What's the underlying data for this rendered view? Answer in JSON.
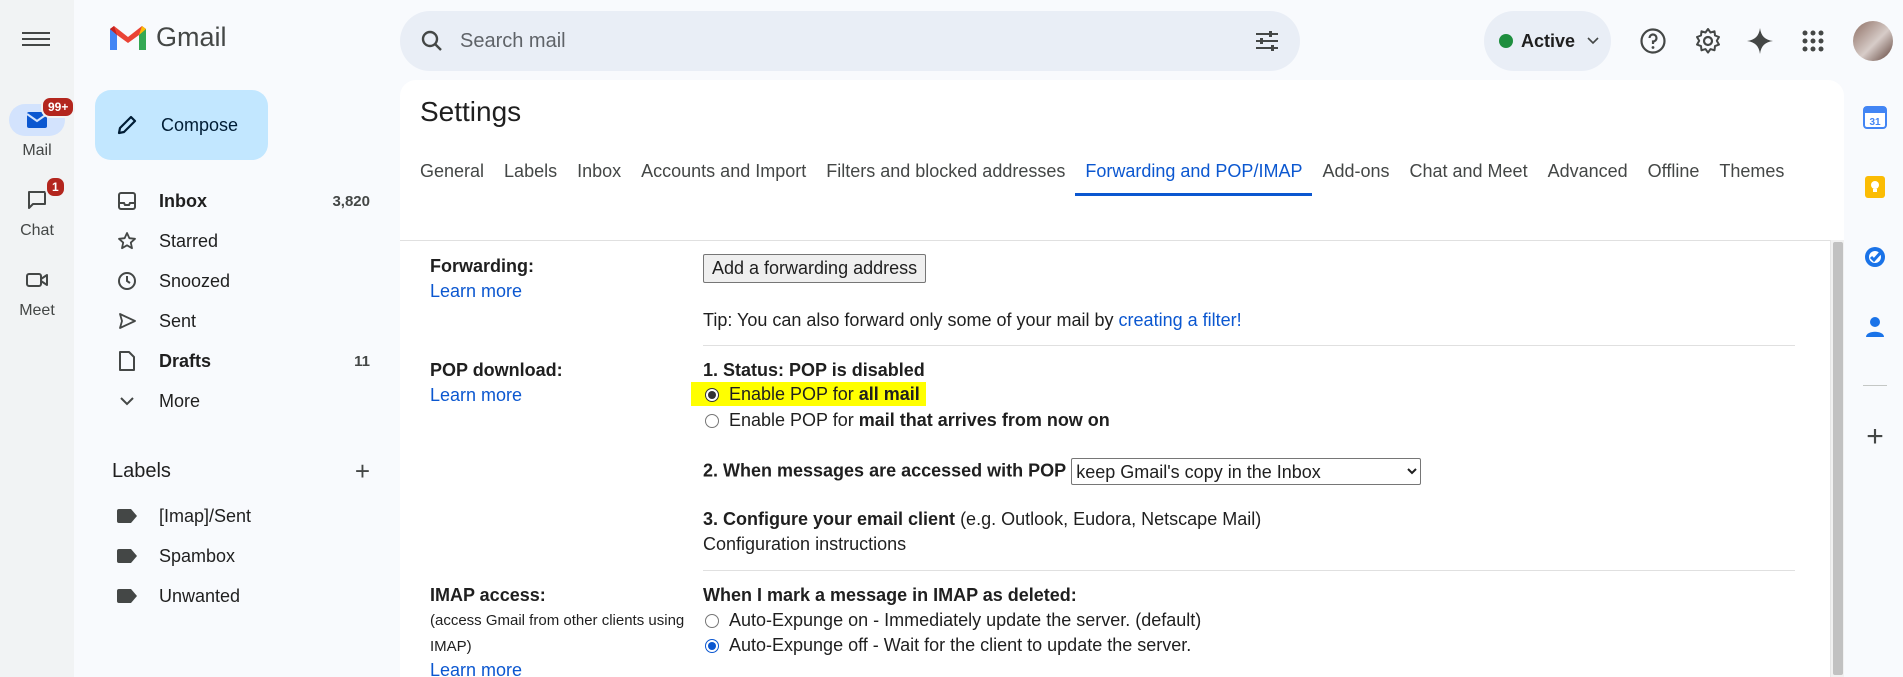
{
  "app": {
    "name": "Gmail"
  },
  "rail": [
    {
      "label": "Mail",
      "badge": "99+",
      "icon": "mail-icon"
    },
    {
      "label": "Chat",
      "badge": "1",
      "icon": "chat-icon"
    },
    {
      "label": "Meet",
      "badge": "",
      "icon": "video-icon"
    }
  ],
  "compose": {
    "label": "Compose"
  },
  "nav": [
    {
      "label": "Inbox",
      "count": "3,820",
      "icon": "inbox-icon",
      "bold": true
    },
    {
      "label": "Starred",
      "count": "",
      "icon": "star-icon"
    },
    {
      "label": "Snoozed",
      "count": "",
      "icon": "clock-icon"
    },
    {
      "label": "Sent",
      "count": "",
      "icon": "send-icon"
    },
    {
      "label": "Drafts",
      "count": "11",
      "icon": "draft-icon",
      "bold": true
    },
    {
      "label": "More",
      "count": "",
      "icon": "chevron-down-icon"
    }
  ],
  "labels": {
    "heading": "Labels",
    "items": [
      "[Imap]/Sent",
      "Spambox",
      "Unwanted"
    ]
  },
  "search": {
    "placeholder": "Search mail"
  },
  "status": {
    "label": "Active",
    "color": "#1e8e3e"
  },
  "settings": {
    "title": "Settings",
    "tabs": [
      "General",
      "Labels",
      "Inbox",
      "Accounts and Import",
      "Filters and blocked addresses",
      "Forwarding and POP/IMAP",
      "Add-ons",
      "Chat and Meet",
      "Advanced",
      "Offline",
      "Themes"
    ],
    "active_tab": "Forwarding and POP/IMAP",
    "forwarding": {
      "label": "Forwarding:",
      "learn_more": "Learn more",
      "button": "Add a forwarding address",
      "tip_prefix": "Tip: You can also forward only some of your mail by ",
      "tip_link": "creating a filter!"
    },
    "pop": {
      "label": "POP download:",
      "learn_more": "Learn more",
      "status": "1. Status: POP is disabled",
      "option1_prefix": "Enable POP for ",
      "option1_bold": "all mail",
      "option2_prefix": "Enable POP for ",
      "option2_bold": "mail that arrives from now on",
      "when_accessed": "2. When messages are accessed with POP",
      "when_accessed_value": "keep Gmail's copy in the Inbox",
      "configure_bold": "3. Configure your email client",
      "configure_rest": " (e.g. Outlook, Eudora, Netscape Mail)",
      "config_link": "Configuration instructions"
    },
    "imap": {
      "label": "IMAP access:",
      "sublabel": "(access Gmail from other clients using IMAP)",
      "learn_more": "Learn more",
      "deleted_heading": "When I mark a message in IMAP as deleted:",
      "expunge_on": "Auto-Expunge on - Immediately update the server. (default)",
      "expunge_off": "Auto-Expunge off - Wait for the client to update the server."
    }
  },
  "colors": {
    "accent": "#0b57d0",
    "compose_bg": "#c2e7ff",
    "highlight": "#ffff00"
  }
}
